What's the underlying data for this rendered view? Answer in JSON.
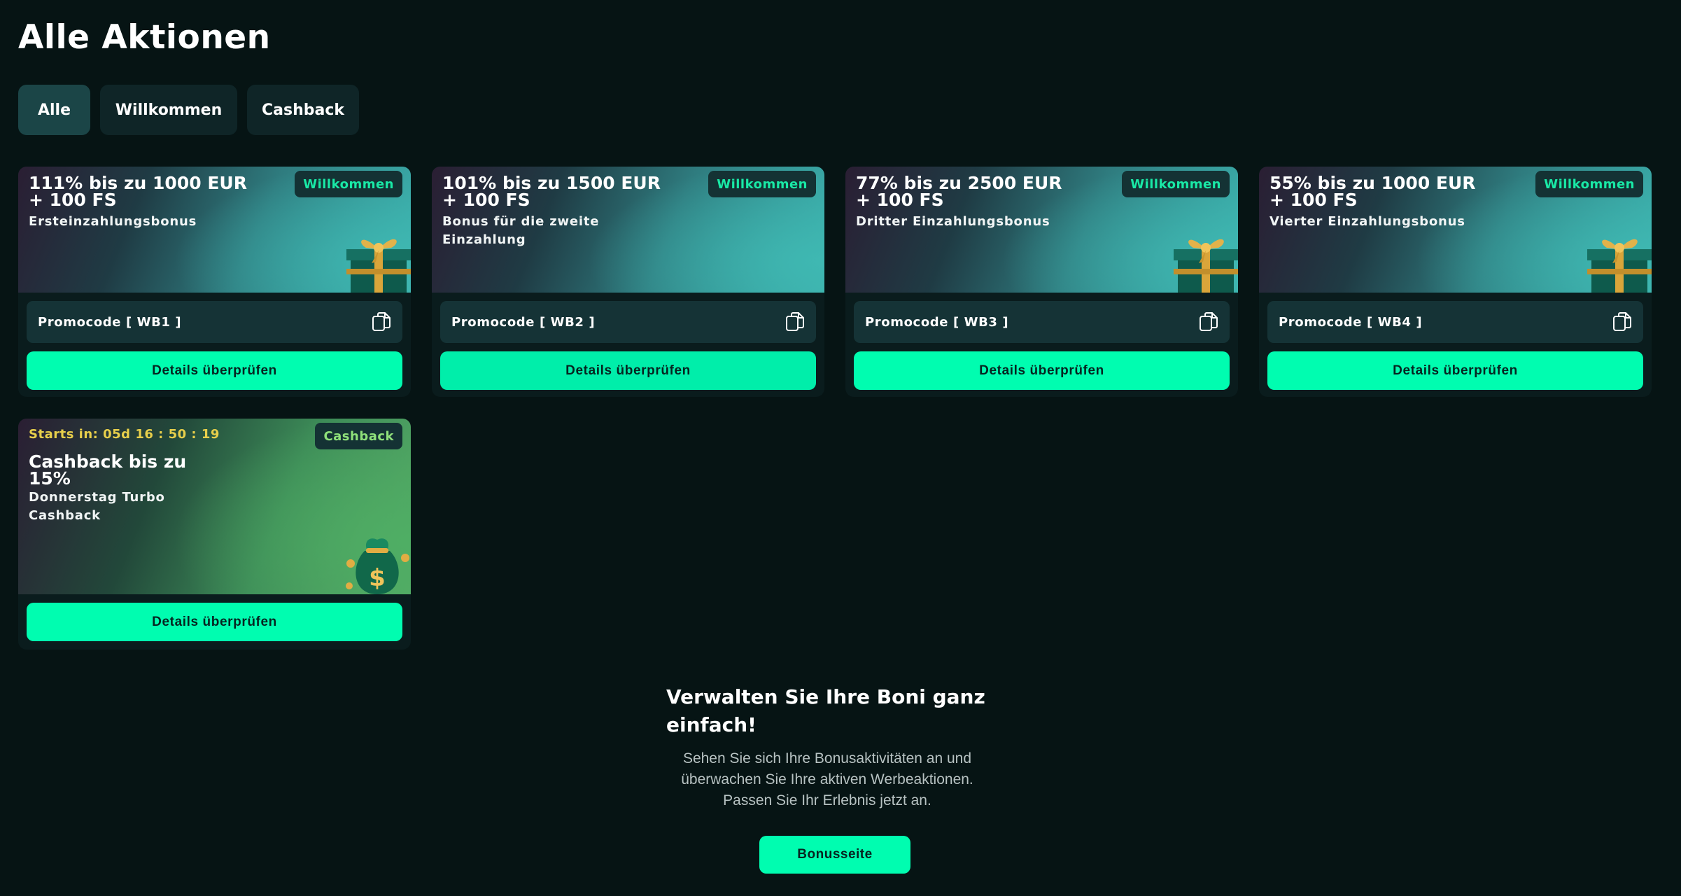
{
  "page": {
    "title": "Alle Aktionen"
  },
  "filters": [
    {
      "label": "Alle",
      "active": true
    },
    {
      "label": "Willkommen",
      "active": false
    },
    {
      "label": "Cashback",
      "active": false
    }
  ],
  "promotions": [
    {
      "title": "111% bis zu 1000 EUR + 100 FS",
      "subtitle": "Ersteinzahlungsbonus",
      "badge": "Willkommen",
      "promo_label": "Promocode [ WB1 ]",
      "button": "Details überprüfen",
      "image": "gift-box-icon"
    },
    {
      "title": "101% bis zu 1500 EUR + 100 FS",
      "subtitle": "Bonus für die zweite Einzahlung",
      "badge": "Willkommen",
      "promo_label": "Promocode [ WB2 ]",
      "button": "Details überprüfen",
      "image": ""
    },
    {
      "title": "77% bis zu 2500 EUR + 100 FS",
      "subtitle": "Dritter Einzahlungsbonus",
      "badge": "Willkommen",
      "promo_label": "Promocode [ WB3 ]",
      "button": "Details überprüfen",
      "image": "gift-box-icon"
    },
    {
      "title": "55% bis zu 1000 EUR + 100 FS",
      "subtitle": "Vierter Einzahlungsbonus",
      "badge": "Willkommen",
      "promo_label": "Promocode [ WB4 ]",
      "button": "Details überprüfen",
      "image": "gift-box-icon"
    }
  ],
  "cashback": {
    "countdown": "Starts in: 05d 16 : 50 : 19",
    "title": "Cashback bis zu 15%",
    "subtitle": "Donnerstag Turbo Cashback",
    "badge": "Cashback",
    "button": "Details überprüfen",
    "image": "money-bag-icon"
  },
  "info": {
    "title": "Verwalten Sie Ihre Boni ganz einfach!",
    "text": "Sehen Sie sich Ihre Bonusaktivitäten an und überwachen Sie Ihre aktiven Werbeaktionen. Passen Sie Ihr Erlebnis jetzt an.",
    "button": "Bonusseite"
  },
  "colors": {
    "background": "#061414",
    "accent": "#00fdb0",
    "badge_text": "#19e9a6",
    "countdown": "#e8cf4b"
  },
  "icons": {
    "copy": "copy-icon"
  }
}
